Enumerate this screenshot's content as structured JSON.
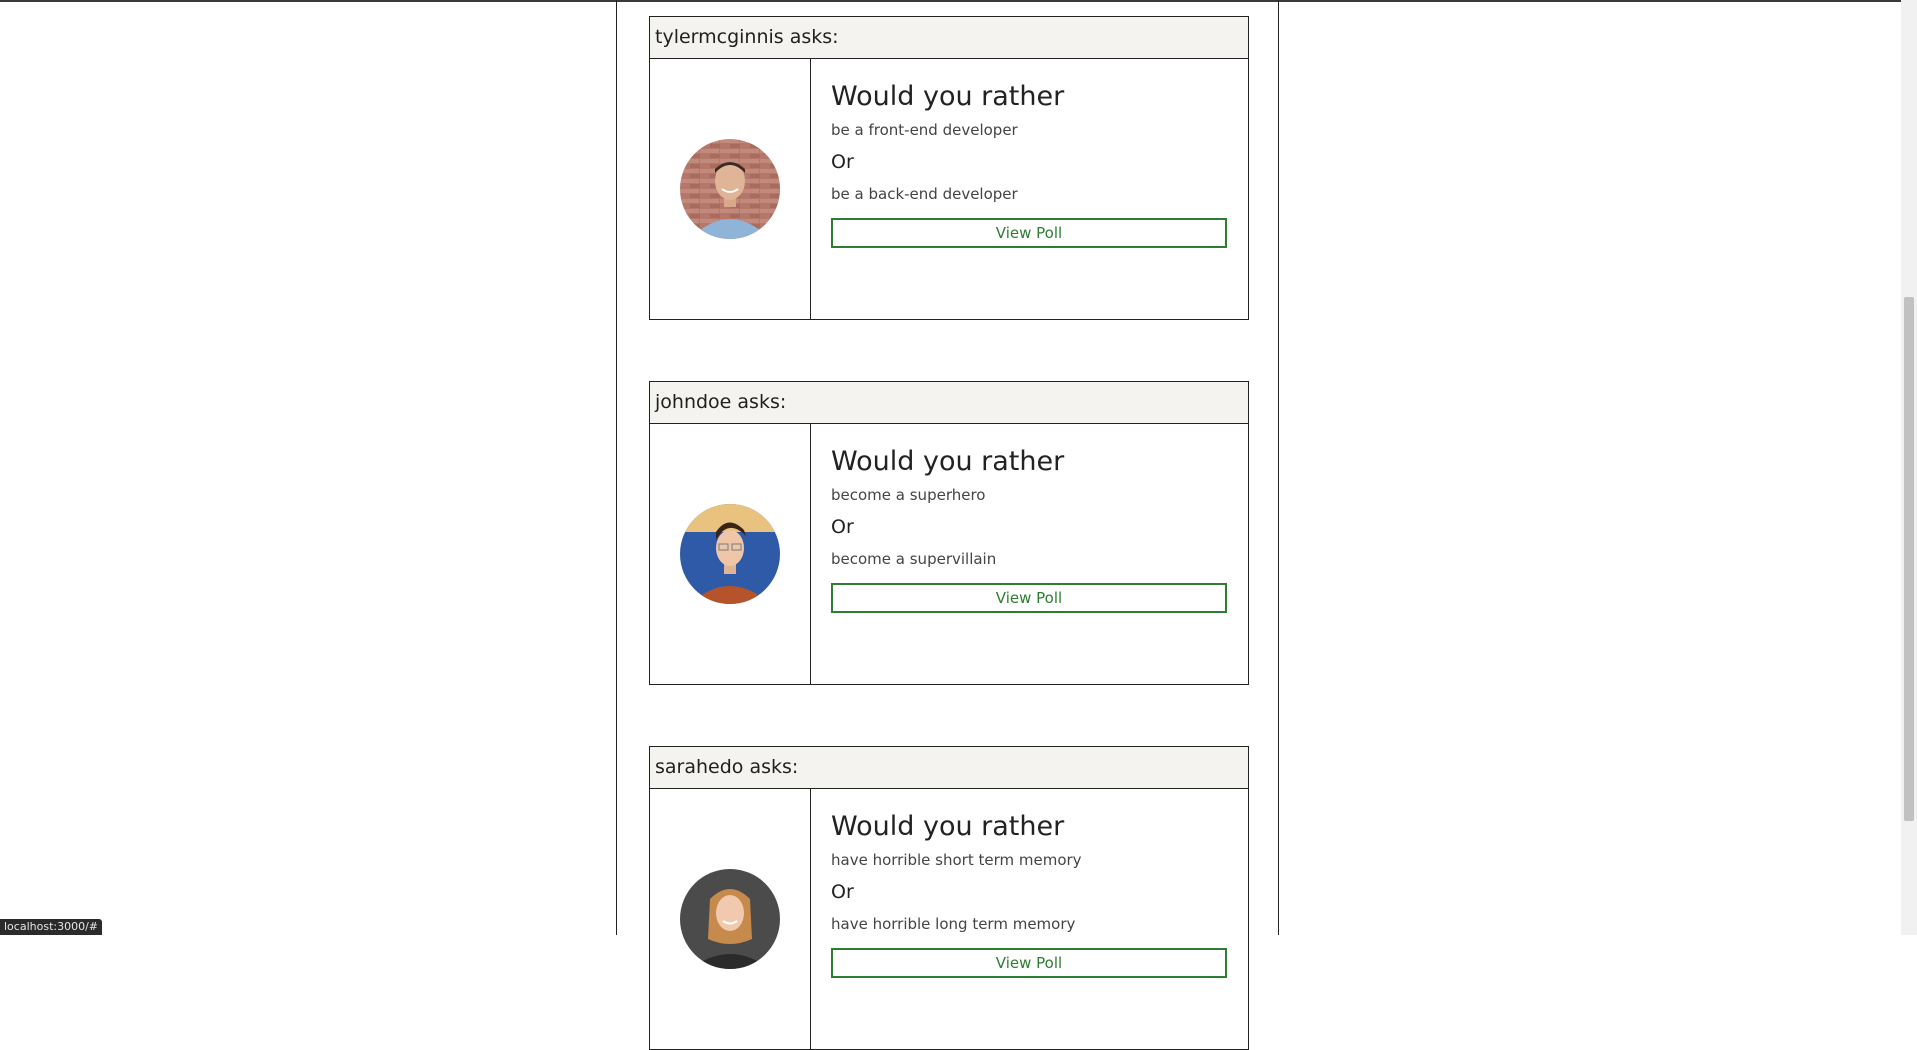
{
  "cards": [
    {
      "asker": "tylermcginnis asks:",
      "heading": "Would you rather",
      "option_one": "be a front-end developer",
      "or_label": "Or",
      "option_two": "be a back-end developer",
      "button_label": "View Poll"
    },
    {
      "asker": "johndoe asks:",
      "heading": "Would you rather",
      "option_one": "become a superhero",
      "or_label": "Or",
      "option_two": "become a supervillain",
      "button_label": "View Poll"
    },
    {
      "asker": "sarahedo asks:",
      "heading": "Would you rather",
      "option_one": "have horrible short term memory",
      "or_label": "Or",
      "option_two": "have horrible long term memory",
      "button_label": "View Poll"
    }
  ],
  "status_bar": {
    "url": "localhost:3000/#"
  },
  "colors": {
    "accent": "#2e7d32",
    "header_bg": "#f4f3ef"
  }
}
